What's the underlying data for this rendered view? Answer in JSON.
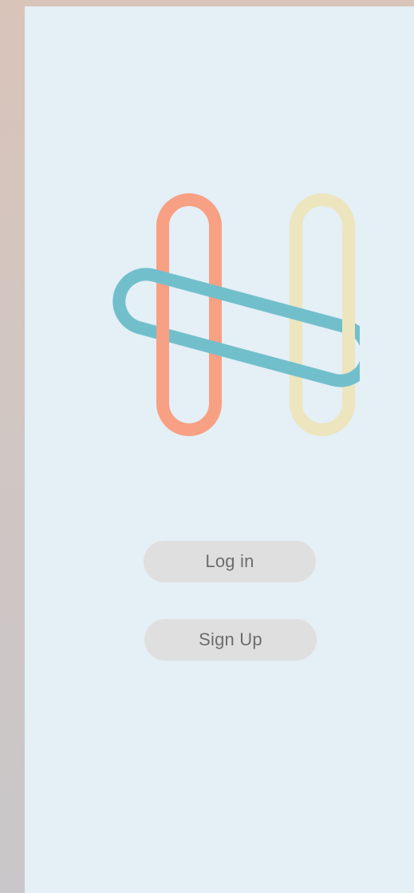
{
  "app": {
    "logo_name": "paperclip-h-logo",
    "colors": {
      "background": "#e4eff6",
      "left_loop": "#f8a083",
      "right_loop": "#ece5be",
      "cross_loop": "#72bfcc",
      "button_bg": "#dfdfdf",
      "button_text": "#6d6d6d"
    }
  },
  "auth": {
    "login_label": "Log in",
    "signup_label": "Sign Up"
  }
}
